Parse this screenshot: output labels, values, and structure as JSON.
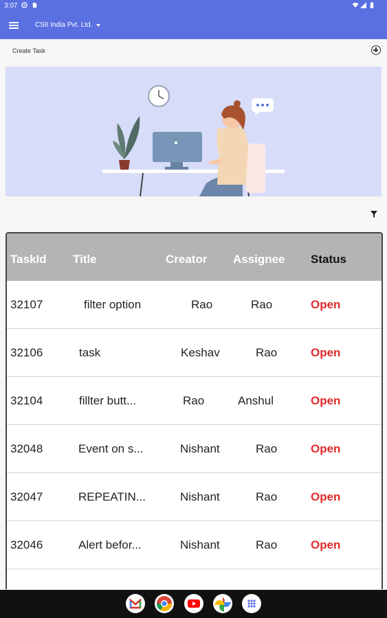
{
  "status_bar": {
    "time": "3:07"
  },
  "app_bar": {
    "company": "CSII India Pvt. Ltd."
  },
  "create_task": {
    "label": "Create Task"
  },
  "table": {
    "headers": [
      "TaskId",
      "Title",
      "Creator",
      "Assignee",
      "Status"
    ],
    "rows": [
      {
        "id": "32107",
        "title": "filter option",
        "creator": "Rao",
        "assignee": "Rao",
        "status": "Open"
      },
      {
        "id": "32106",
        "title": "task",
        "creator": "Keshav",
        "assignee": "Rao",
        "status": "Open"
      },
      {
        "id": "32104",
        "title": "fillter butt...",
        "creator": "Rao",
        "assignee": "Anshul",
        "status": "Open"
      },
      {
        "id": "32048",
        "title": "Event on s...",
        "creator": "Nishant",
        "assignee": "Rao",
        "status": "Open"
      },
      {
        "id": "32047",
        "title": "REPEATIN...",
        "creator": "Nishant",
        "assignee": "Rao",
        "status": "Open"
      },
      {
        "id": "32046",
        "title": "Alert befor...",
        "creator": "Nishant",
        "assignee": "Rao",
        "status": "Open"
      }
    ]
  },
  "dock_apps": [
    "gmail-icon",
    "chrome-icon",
    "youtube-icon",
    "photos-icon",
    "app-drawer-icon"
  ],
  "colors": {
    "app_bar": "#5a6fe0",
    "banner": "#d7dcf9",
    "header": "#b4b4b4",
    "open_status": "#e32a2a"
  }
}
